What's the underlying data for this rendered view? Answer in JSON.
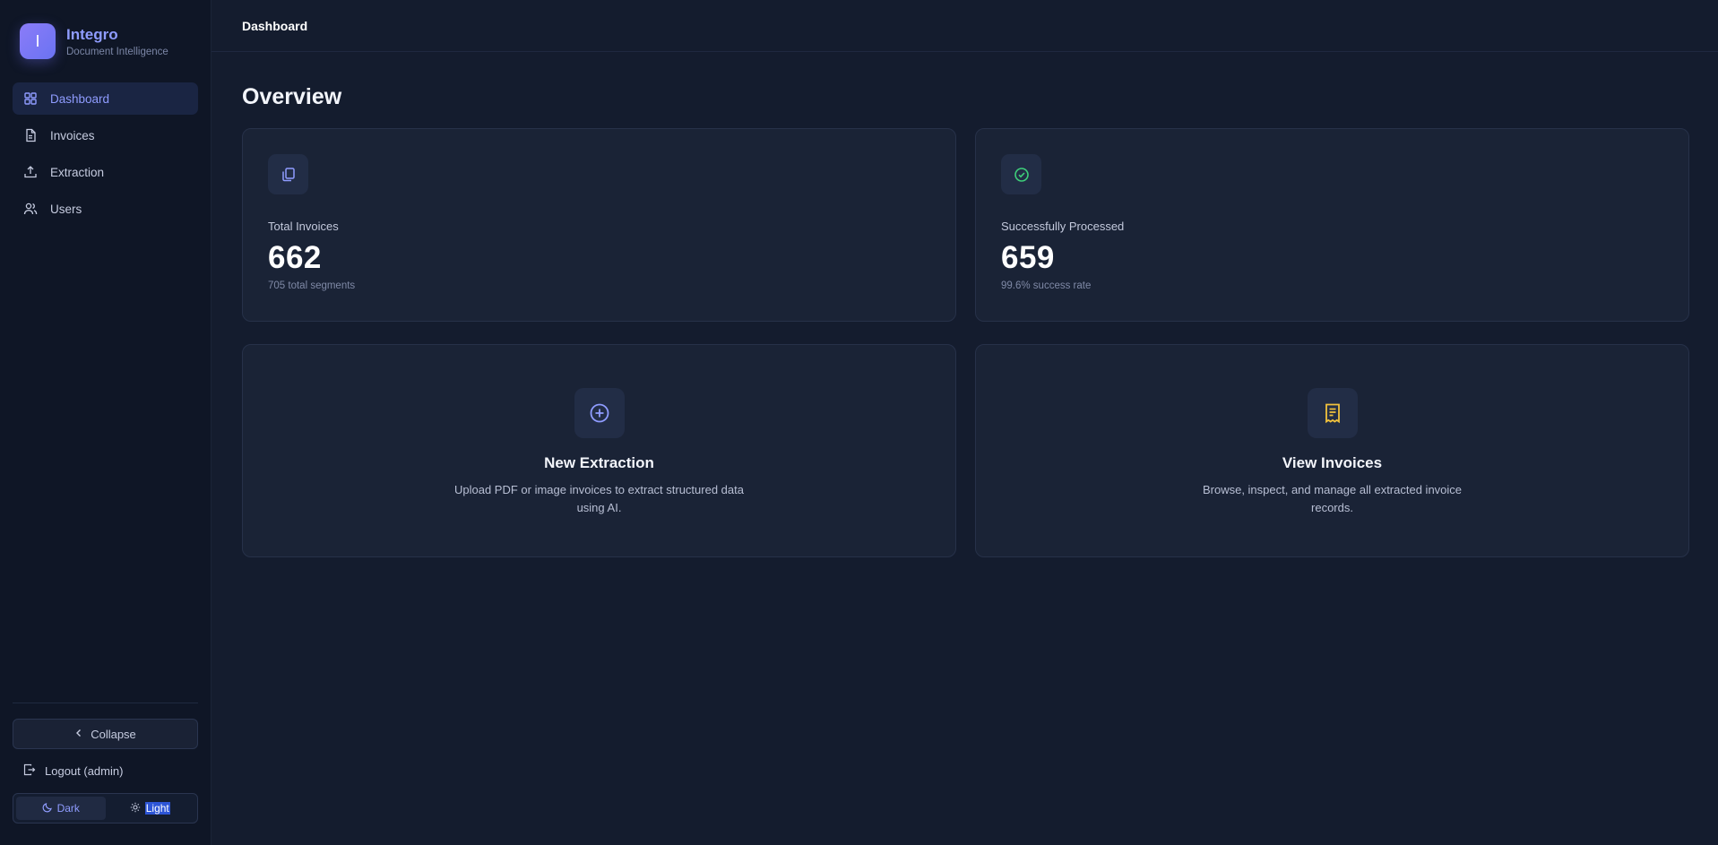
{
  "brand": {
    "logo_letter": "I",
    "name": "Integro",
    "subtitle": "Document Intelligence"
  },
  "sidebar": {
    "items": [
      {
        "label": "Dashboard",
        "icon": "grid-icon",
        "active": true
      },
      {
        "label": "Invoices",
        "icon": "file-icon",
        "active": false
      },
      {
        "label": "Extraction",
        "icon": "upload-icon",
        "active": false
      },
      {
        "label": "Users",
        "icon": "users-icon",
        "active": false
      }
    ],
    "collapse_label": "Collapse",
    "logout_label": "Logout (admin)",
    "theme": {
      "dark_label": "Dark",
      "light_label": "Light",
      "selected": "Dark"
    }
  },
  "topbar": {
    "title": "Dashboard"
  },
  "main": {
    "title": "Overview",
    "stats": [
      {
        "label": "Total Invoices",
        "value": "662",
        "sub": "705 total segments",
        "icon": "copy-icon"
      },
      {
        "label": "Successfully Processed",
        "value": "659",
        "sub": "99.6% success rate",
        "icon": "check-circle-icon"
      }
    ],
    "actions": [
      {
        "title": "New Extraction",
        "description": "Upload PDF or image invoices to extract structured data using AI.",
        "icon": "plus-circle-icon"
      },
      {
        "title": "View Invoices",
        "description": "Browse, inspect, and manage all extracted invoice records.",
        "icon": "receipt-icon"
      }
    ]
  },
  "colors": {
    "accent": "#8f9cff",
    "success": "#3ecf7a",
    "warning": "#f2c23c",
    "background": "#141c2e",
    "sidebar": "#0f1626",
    "card": "#1a2336"
  }
}
